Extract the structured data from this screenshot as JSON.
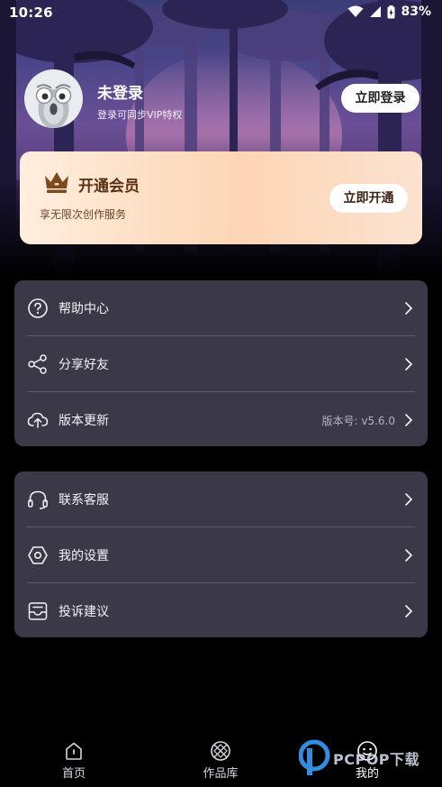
{
  "status_bar": {
    "time": "10:26",
    "battery": "83%"
  },
  "profile": {
    "username": "未登录",
    "tip": "登录可同步VIP特权",
    "login_button": "立即登录"
  },
  "vip": {
    "title": "开通会员",
    "subtitle": "享无限次创作服务",
    "button": "立即开通",
    "icon": "crown-icon"
  },
  "menu_group_1": [
    {
      "label": "帮助中心",
      "icon": "help-circle-icon"
    },
    {
      "label": "分享好友",
      "icon": "share-icon"
    },
    {
      "label": "版本更新",
      "icon": "cloud-upload-icon",
      "value": "版本号: v5.6.0"
    }
  ],
  "menu_group_2": [
    {
      "label": "联系客服",
      "icon": "headset-icon"
    },
    {
      "label": "我的设置",
      "icon": "settings-hexagon-icon"
    },
    {
      "label": "投诉建议",
      "icon": "feedback-inbox-icon"
    }
  ],
  "bottom_nav": [
    {
      "label": "首页",
      "icon": "home-icon"
    },
    {
      "label": "作品库",
      "icon": "gallery-icon"
    },
    {
      "label": "我的",
      "icon": "profile-icon",
      "active": true
    }
  ],
  "watermark": {
    "text": "PCPOP下载"
  },
  "colors": {
    "card_bg": "#3b3848",
    "page_bg": "#000000",
    "vip_gold": "#5a3110"
  }
}
